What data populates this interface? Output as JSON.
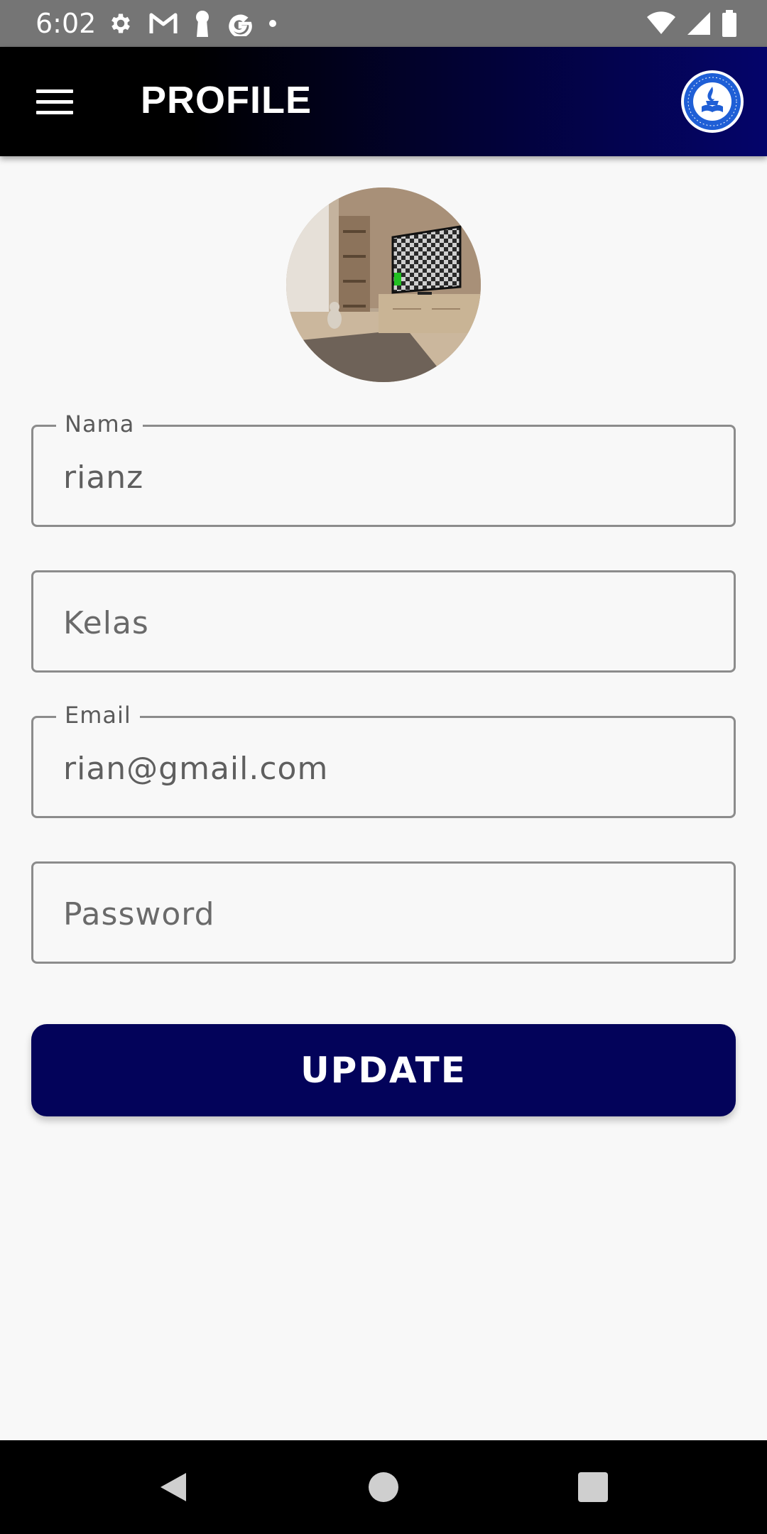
{
  "status_bar": {
    "time": "6:02",
    "left_icons": [
      "settings-icon",
      "gmail-icon",
      "keyhole-icon",
      "google-icon",
      "dot-icon"
    ],
    "right_icons": [
      "wifi-icon",
      "cellular-icon",
      "battery-icon"
    ]
  },
  "app_bar": {
    "title": "PROFILE",
    "menu_icon": "hamburger-menu-icon",
    "logo": "school-logo"
  },
  "profile": {
    "avatar": "profile-photo"
  },
  "form": {
    "nama": {
      "label": "Nama",
      "value": "rianz"
    },
    "kelas": {
      "placeholder": "Kelas",
      "value": ""
    },
    "email": {
      "label": "Email",
      "value": "rian@gmail.com"
    },
    "password": {
      "placeholder": "Password",
      "value": ""
    }
  },
  "actions": {
    "update_label": "UPDATE"
  },
  "nav_bar": {
    "icons": [
      "back-icon",
      "home-icon",
      "recents-icon"
    ]
  },
  "colors": {
    "status_bar": "#757575",
    "app_bar_start": "#000000",
    "app_bar_end": "#04046a",
    "button": "#03035a",
    "background": "#f8f8f8"
  }
}
